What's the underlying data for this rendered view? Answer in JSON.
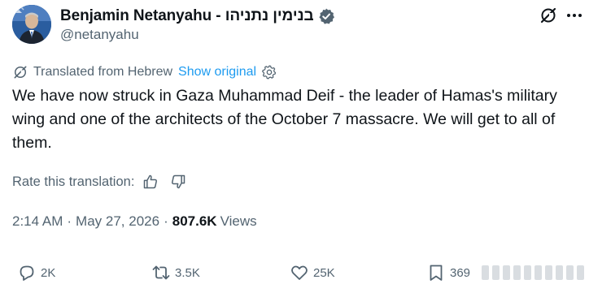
{
  "author": {
    "display_name": "Benjamin Netanyahu - בנימין נתניהו",
    "handle": "@netanyahu",
    "verified": true,
    "avatar_icon": "profile-photo"
  },
  "header_actions": {
    "grok_icon": "grok-icon",
    "more_icon": "more-icon"
  },
  "translation": {
    "label": "Translated from Hebrew",
    "show_original": "Show original",
    "rate_label": "Rate this translation:"
  },
  "tweet": {
    "text": "We have now struck in Gaza Muhammad Deif - the leader of Hamas's military wing and one of the architects of the October 7 massacre. We will get to all of them."
  },
  "meta": {
    "time": "2:14 AM",
    "separator": "·",
    "date": "May 27, 2026",
    "views_count": "807.6K",
    "views_label": "Views"
  },
  "actions": {
    "replies": "2K",
    "reposts": "3.5K",
    "likes": "25K",
    "bookmarks": "369"
  },
  "colors": {
    "text": "#0f1419",
    "secondary": "#536471",
    "link": "#1d9bf0",
    "verified_badge": "#536471"
  }
}
